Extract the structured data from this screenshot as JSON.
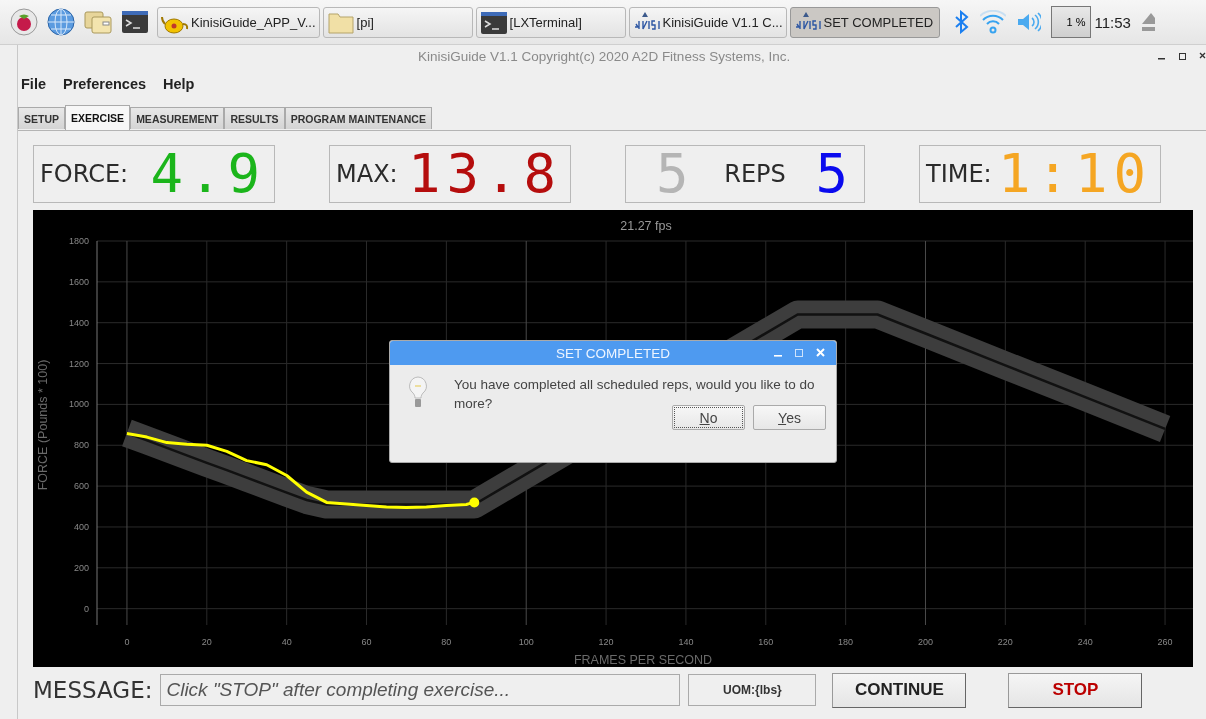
{
  "taskbar": {
    "launchers": [
      {
        "kind": "raspberry"
      },
      {
        "kind": "globe"
      },
      {
        "kind": "folders"
      },
      {
        "kind": "terminal"
      }
    ],
    "tasks": [
      {
        "label": "KinisiGuide_APP_V...",
        "kind": "teapot",
        "selected": false
      },
      {
        "label": "[pi]",
        "kind": "folder",
        "selected": false
      },
      {
        "label": "[LXTerminal]",
        "kind": "terminal",
        "selected": false
      },
      {
        "label": "KinisiGuide V1.1 C...",
        "kind": "kinisi",
        "selected": false
      },
      {
        "label": "SET COMPLETED",
        "kind": "kinisi",
        "selected": true
      }
    ],
    "cpu": "1 %",
    "clock": "11:53"
  },
  "window": {
    "title": "KinisiGuide V1.1 Copyright(c) 2020 A2D Fitness Systems, Inc."
  },
  "menu": [
    "File",
    "Preferences",
    "Help"
  ],
  "tabs": [
    {
      "label": "SETUP",
      "selected": false
    },
    {
      "label": "EXERCISE",
      "selected": true
    },
    {
      "label": "MEASUREMENT",
      "selected": false
    },
    {
      "label": "RESULTS",
      "selected": false
    },
    {
      "label": "PROGRAM MAINTENANCE",
      "selected": false
    }
  ],
  "readouts": [
    {
      "kind": "labeled",
      "label": "FORCE:",
      "value": "4.9",
      "color": "#1bb51b"
    },
    {
      "kind": "labeled",
      "label": "MAX:",
      "value": "13.8",
      "color": "#b50d0d"
    },
    {
      "kind": "count",
      "prefix": "5",
      "label": "REPS",
      "value": "5",
      "color": "#0a0aee"
    },
    {
      "kind": "labeled",
      "label": "TIME:",
      "value": "1:10",
      "color": "#f5a623"
    }
  ],
  "chart_data": {
    "type": "line",
    "title": "21.27 fps",
    "xlabel": "FRAMES PER SECOND",
    "ylabel": "FORCE (Pounds * 100)",
    "x": [
      0,
      5,
      10,
      15,
      20,
      25,
      30,
      35,
      40,
      45,
      50,
      55,
      60,
      65,
      70,
      75,
      80,
      85,
      87,
      168,
      180,
      188,
      200,
      220,
      240,
      260
    ],
    "series": [
      {
        "color": "#3d3d3d",
        "values": [
          860,
          824,
          787,
          751,
          714,
          678,
          641,
          605,
          568,
          532,
          510,
          510,
          510,
          510,
          510,
          510,
          510,
          510,
          510,
          1440,
          1440,
          1440,
          1347,
          1191,
          1036,
          880
        ]
      },
      {
        "color": "#ffff00",
        "values": [
          857,
          840,
          813,
          805,
          800,
          770,
          725,
          705,
          652,
          570,
          520,
          512,
          505,
          498,
          495,
          498,
          505,
          510,
          520,
          null,
          null,
          null,
          null,
          null,
          null,
          null
        ]
      }
    ],
    "grid": true,
    "xlim": [
      -7.5,
      267
    ],
    "ylim": [
      -80,
      1800
    ],
    "xticks": [
      0,
      20,
      40,
      60,
      80,
      100,
      120,
      140,
      160,
      180,
      200,
      220,
      240,
      260
    ],
    "yticks": [
      0,
      200,
      400,
      600,
      800,
      1000,
      1200,
      1400,
      1600,
      1800
    ]
  },
  "dialog": {
    "title": "SET COMPLETED",
    "message": "You have completed all scheduled reps, would you like to do more?",
    "buttons": [
      {
        "label": "No",
        "selected": true
      },
      {
        "label": "Yes",
        "selected": false
      }
    ]
  },
  "footer": {
    "label": "MESSAGE:",
    "message": "Click \"STOP\" after completing exercise...",
    "uom": "UOM:{lbs}",
    "buttons": [
      {
        "label": "CONTINUE",
        "kind": "normal"
      },
      {
        "label": "STOP",
        "kind": "danger"
      }
    ]
  }
}
